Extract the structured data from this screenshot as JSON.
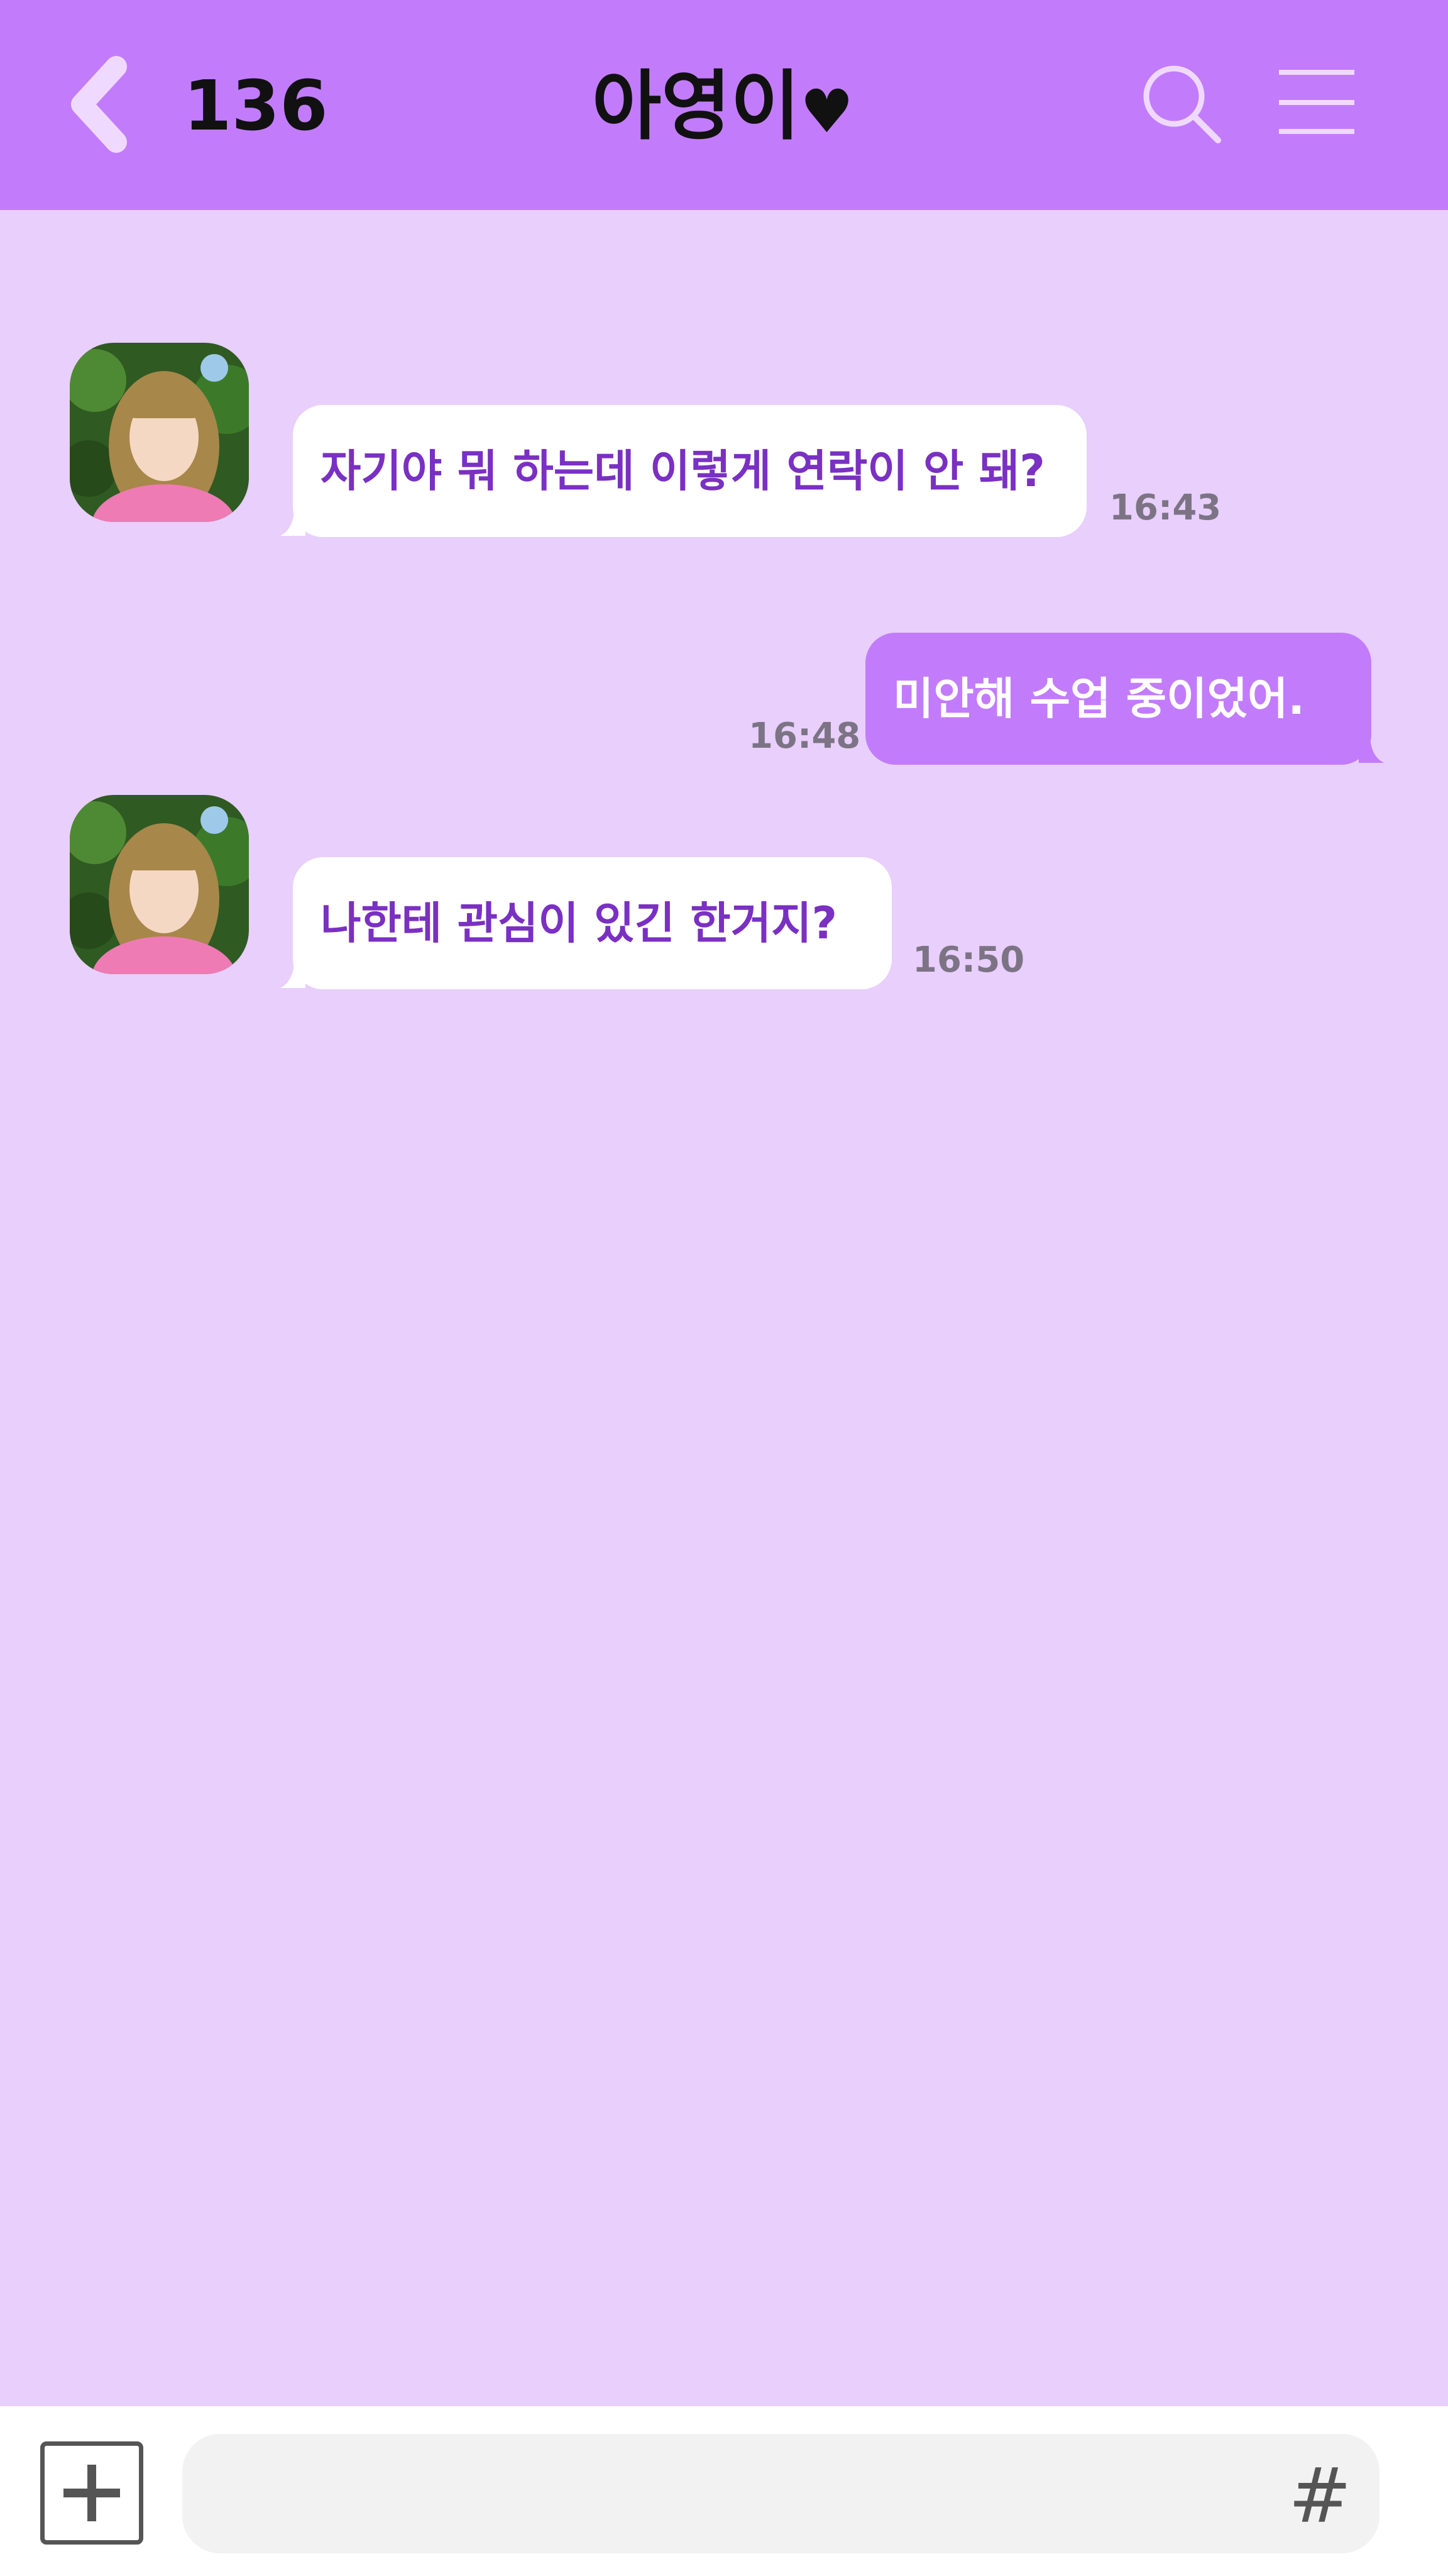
{
  "header": {
    "unread_count": "136",
    "title": "아영이",
    "title_heart": "♥",
    "back_icon": "chevron-left-icon",
    "search_icon": "search-icon",
    "menu_icon": "menu-icon"
  },
  "messages": [
    {
      "direction": "incoming",
      "text": "자기야 뭐 하는데 이렇게 연락이 안 돼?",
      "time": "16:43"
    },
    {
      "direction": "outgoing",
      "text": "미안해 수업 중이었어.",
      "time": "16:48"
    },
    {
      "direction": "incoming",
      "text": "나한테 관심이 있긴 한거지?",
      "time": "16:50"
    }
  ],
  "composer": {
    "plus_icon": "plus-icon",
    "hash_label": "#",
    "placeholder": ""
  },
  "colors": {
    "header": "#c27cfb",
    "background": "#e8cffc",
    "incoming_bubble": "#ffffff",
    "incoming_text": "#7a30c2",
    "outgoing_bubble": "#c27cfb",
    "outgoing_text": "#ffffff"
  }
}
